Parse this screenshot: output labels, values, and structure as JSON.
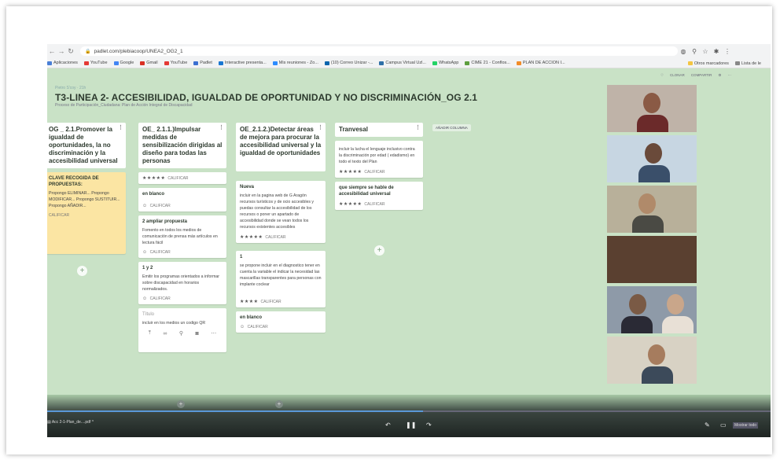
{
  "browser": {
    "url": "padlet.com/plebiacoop/UNEA2_OG2_1",
    "bookmarks": [
      "Aplicaciones",
      "YouTube",
      "Google",
      "Gmail",
      "YouTube",
      "Padlet",
      "Interactive presenta...",
      "Mis reuniones - Zo...",
      "(10) Correo Unizar -...",
      "Campus Virtual Uzl...",
      "WhatsApp",
      "CIME 21 - Conflos...",
      "PLAN DE ACCION I..."
    ],
    "bookmarks_right": [
      "Otros marcadores",
      "Lista de le"
    ]
  },
  "padlet": {
    "author": "Pietro S'coy · 21h",
    "title": "T3-LINEA 2- ACCESIBILIDAD, IGUALDAD DE OPORTUNIDAD Y NO DISCRIMINACIÓN_OG 2.1",
    "subtitle": "Proceso de Participación_Ciudadana: Plan de Acción Integral de Discapacidad",
    "header_actions": [
      "CLONAR",
      "COMPARTIR"
    ],
    "add_column": "AÑADIR COLUMNA",
    "columns": [
      {
        "title": "OG _ 2.1.Promover la igualdad de oportunidades, la no discriminación y la accesibilidad universal",
        "cards": [
          {
            "title": "CLAVE RECOGIDA DE PROPUESTAS:",
            "body": "Propongo ELIMINAR... Propongo MODIFICAR... Propongo SUSTITUIR... Propongo AÑADIR...",
            "rating": "CALIFICAR"
          }
        ]
      },
      {
        "title": "OE_ 2.1.1.)Impulsar medidas de sensibilización dirigidas al diseño para todas las personas",
        "cards": [
          {
            "title": "",
            "body": "",
            "rating": "CALIFICAR"
          },
          {
            "title": "en blanco",
            "body": "",
            "rating": "CALIFICAR"
          },
          {
            "title": "2 ampliar propuesta",
            "body": "Fomento en todos los medios de comunicación de prensa más artículos en lectura fácil",
            "rating": "CALIFICAR"
          },
          {
            "title": "1 y 2",
            "body": "Emitir los programas orientados a informar sobre discapacidad en horarios normalizados.",
            "rating": "CALIFICAR"
          },
          {
            "title": "Título",
            "body": "incluir en los medios un codigo QR"
          }
        ]
      },
      {
        "title": "OE_2.1.2.)Detectar áreas de mejora para procurar la accesibilidad universal y la igualdad de oportunidades",
        "cards": [
          {
            "title": "Nueva",
            "body": "incluir en la pagina web de G Aragón recursos turísticos y de ocio accesibles y puedas consultar la accesibilidad de los recursos o poner un apartado de accesibilidad donde se vean todos los recursos existentes accesibles",
            "rating": "CALIFICAR"
          },
          {
            "title": "1",
            "body": "se propone incluir en el diagnostico tener en cuenta la variable el indicar la necesidad las mascarillas transparentes para personas con implante coclear",
            "rating": "CALIFICAR"
          },
          {
            "title": "en blanco",
            "body": "",
            "rating": "CALIFICAR"
          }
        ]
      },
      {
        "title": "Tranvesal",
        "cards": [
          {
            "title": "",
            "body": "incluir la lucha el lenguaje inclusivo contra la discriminación por edad ( edadismo) en todo el texto del Plan",
            "rating": "CALIFICAR"
          },
          {
            "title": "que siempre se hable de accesibilidad universal",
            "body": "",
            "rating": "CALIFICAR"
          }
        ]
      }
    ]
  },
  "video": {
    "file_label": "Acc 2-1-Plan_de....pdf",
    "fullscreen_label": "Mostrar todo",
    "progress": 0.52,
    "participants": 6,
    "colors": {
      "board_bg": "#c9e2c6",
      "card": "#ffffff",
      "yellow_card": "#fbe5a3"
    }
  }
}
